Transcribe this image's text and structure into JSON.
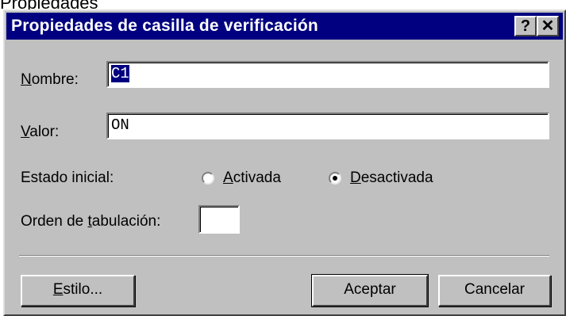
{
  "outer_caption": "Propiedades",
  "dialog": {
    "title": "Propiedades de casilla de verificación",
    "help_button": "?",
    "close_button": "✕"
  },
  "fields": {
    "name": {
      "label_mnemonic": "N",
      "label_rest": "ombre:",
      "value": "C1"
    },
    "value": {
      "label_mnemonic": "V",
      "label_rest": "alor:",
      "value": "ON"
    }
  },
  "initial_state": {
    "label": "Estado inicial:",
    "options": [
      {
        "mnemonic": "A",
        "rest": "ctivada",
        "selected": false
      },
      {
        "mnemonic": "D",
        "rest": "esactivada",
        "selected": true
      }
    ]
  },
  "tab_order": {
    "label_pre": "Orden de ",
    "label_mnemonic": "t",
    "label_post": "abulación:",
    "value": ""
  },
  "buttons": {
    "style_mnemonic": "E",
    "style_rest": "stilo...",
    "ok": "Aceptar",
    "cancel": "Cancelar"
  }
}
